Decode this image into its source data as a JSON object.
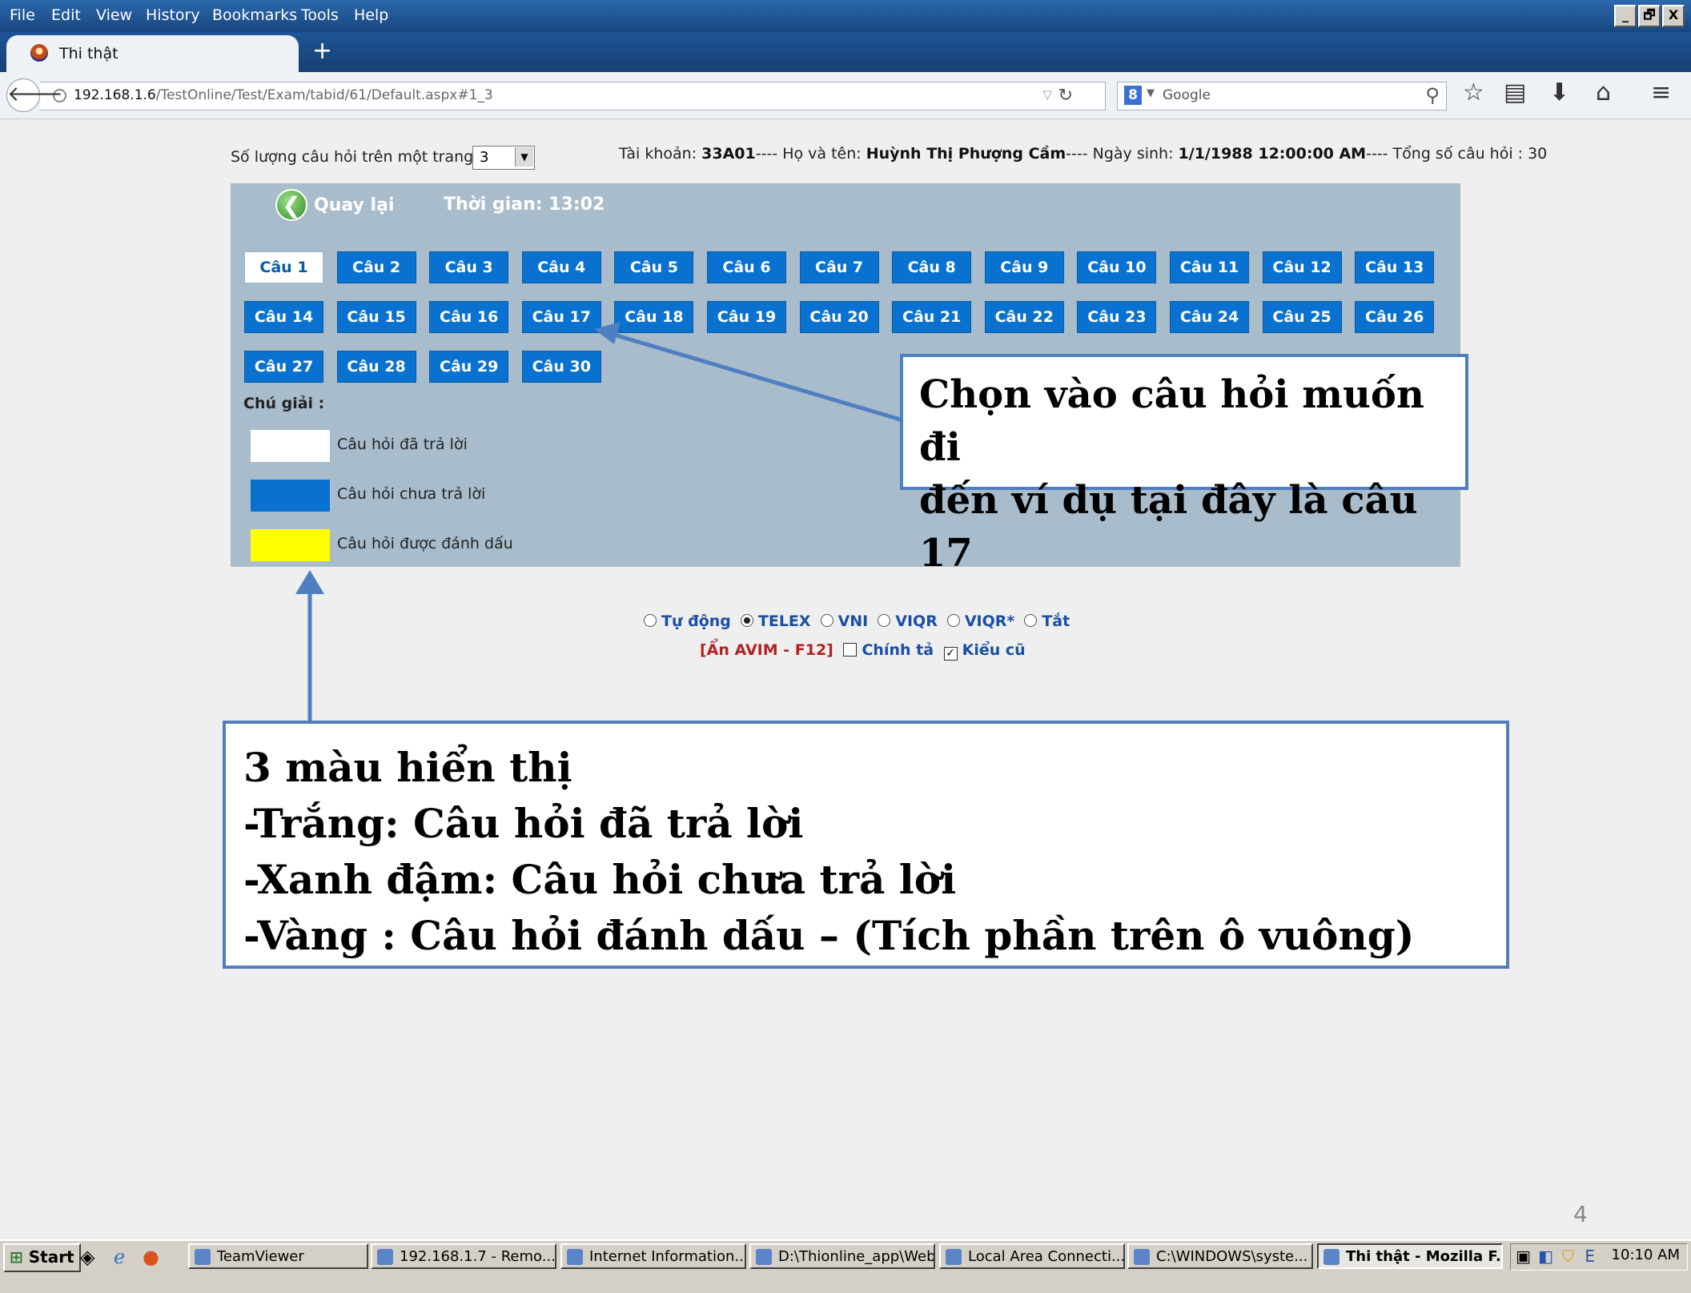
{
  "menu": [
    "File",
    "Edit",
    "View",
    "History",
    "Bookmarks",
    "Tools",
    "Help"
  ],
  "window_buttons": [
    "_",
    "🗗",
    "X"
  ],
  "tab": {
    "title": "Thi thật"
  },
  "newtab": "+",
  "url": {
    "host": "192.168.1.6",
    "path": "/TestOnline/Test/Exam/tabid/61/Default.aspx#1_3"
  },
  "search": {
    "engine_badge": "8",
    "placeholder": "Google"
  },
  "toolbar_icons": [
    "star-icon",
    "bookmarks-list-icon",
    "download-icon",
    "home-icon",
    "menu-icon"
  ],
  "page": {
    "perpage_label": "Số lượng câu hỏi trên một trang :",
    "perpage_value": "3",
    "account": {
      "label1": "Tài khoản: ",
      "value1": "33A01",
      "label2": "---- Họ và tên: ",
      "value2": "Huỳnh Thị Phượng Cầm",
      "label3": "---- Ngày sinh: ",
      "value3": "1/1/1988 12:00:00 AM",
      "label4": "---- Tổng số câu hỏi : 30"
    },
    "back_label": "Quay lại",
    "timer": "Thời gian: 13:02",
    "legend_title": "Chú giải :",
    "legend": [
      {
        "label": "Câu hỏi đã trả lời",
        "color": "#ffffff"
      },
      {
        "label": "Câu hỏi chưa trả lời",
        "color": "#0971cf"
      },
      {
        "label": "Câu hỏi được đánh dấu",
        "color": "#ffff00"
      }
    ],
    "questions": [
      "Câu 1",
      "Câu 2",
      "Câu 3",
      "Câu 4",
      "Câu 5",
      "Câu 6",
      "Câu 7",
      "Câu 8",
      "Câu 9",
      "Câu 10",
      "Câu 11",
      "Câu 12",
      "Câu 13",
      "Câu 14",
      "Câu 15",
      "Câu 16",
      "Câu 17",
      "Câu 18",
      "Câu 19",
      "Câu 20",
      "Câu 21",
      "Câu 22",
      "Câu 23",
      "Câu 24",
      "Câu 25",
      "Câu 26",
      "Câu 27",
      "Câu 28",
      "Câu 29",
      "Câu 30"
    ],
    "answered": [
      "Câu 1"
    ]
  },
  "ime": {
    "options": [
      {
        "label": "Tự động",
        "checked": false
      },
      {
        "label": "TELEX",
        "checked": true
      },
      {
        "label": "VNI",
        "checked": false
      },
      {
        "label": "VIQR",
        "checked": false
      },
      {
        "label": "VIQR*",
        "checked": false
      },
      {
        "label": "Tắt",
        "checked": false
      }
    ],
    "hide_label": "[Ẩn AVIM - F12]",
    "spell_label": "Chính tả",
    "spell_checked": false,
    "old_label": "Kiểu cũ",
    "old_checked": true
  },
  "callout1": [
    "Chọn vào câu hỏi muốn đi",
    "đến ví dụ tại đây là câu 17"
  ],
  "callout2": [
    "3 màu hiển thị",
    "-Trắng: Câu hỏi đã trả lời",
    "-Xanh đậm: Câu hỏi chưa trả lời",
    "-Vàng : Câu hỏi đánh dấu – (Tích phần  trên ô vuông)"
  ],
  "slide_number": "4",
  "taskbar": {
    "start": "Start",
    "tasks": [
      "TeamViewer",
      "192.168.1.7 - Remo...",
      "Internet Information...",
      "D:\\Thionline_app\\Web",
      "Local Area Connecti...",
      "C:\\WINDOWS\\syste...",
      "Thi thật - Mozilla F..."
    ],
    "active_task": "Thi thật - Mozilla F...",
    "clock": "10:10 AM"
  }
}
